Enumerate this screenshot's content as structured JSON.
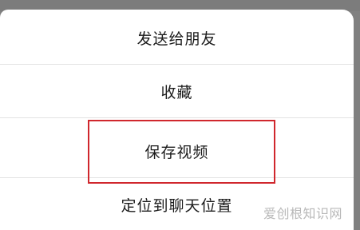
{
  "menu": {
    "items": [
      {
        "label": "发送给朋友"
      },
      {
        "label": "收藏"
      },
      {
        "label": "保存视频"
      },
      {
        "label": "定位到聊天位置"
      }
    ]
  },
  "watermark": {
    "text": "爱创根知识网"
  },
  "colors": {
    "overlay": "#808080",
    "sheet_background": "#ffffff",
    "divider": "#e3e3e3",
    "highlight_border": "#d0272d",
    "text": "#1a1a1a"
  }
}
